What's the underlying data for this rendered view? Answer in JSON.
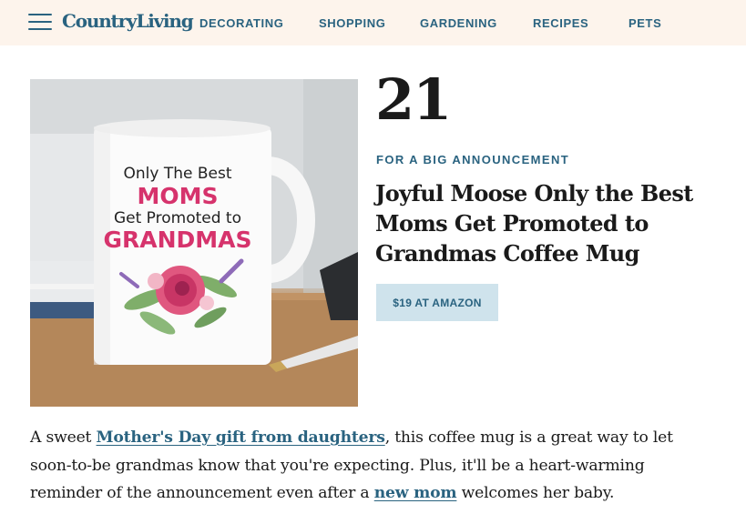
{
  "header": {
    "logo": "CountryLiving",
    "nav": [
      "DECORATING",
      "SHOPPING",
      "GARDENING",
      "RECIPES",
      "PETS"
    ]
  },
  "item": {
    "number": "21",
    "tag": "FOR A BIG ANNOUNCEMENT",
    "title": "Joyful Moose Only the Best Moms Get Promoted to Grandmas Coffee Mug",
    "buy_label": "$19 AT AMAZON",
    "image": {
      "mug_line1": "Only The Best",
      "mug_line2": "MOMS",
      "mug_line3": "Get Promoted to",
      "mug_line4": "GRANDMAS"
    }
  },
  "description": {
    "text_before_link1": "A sweet ",
    "link1": "Mother's Day gift from daughters",
    "text_between": ", this coffee mug is a great way to let soon-to-be grandmas know that you're expecting. Plus, it'll be a heart-warming reminder of the announcement even after a ",
    "link2": "new mom",
    "text_after_link2": " welcomes her baby."
  },
  "colors": {
    "brand": "#2a6380",
    "header_bg": "#fdf4ec",
    "button_bg": "#cfe3ec",
    "mug_pink": "#d6336c"
  }
}
